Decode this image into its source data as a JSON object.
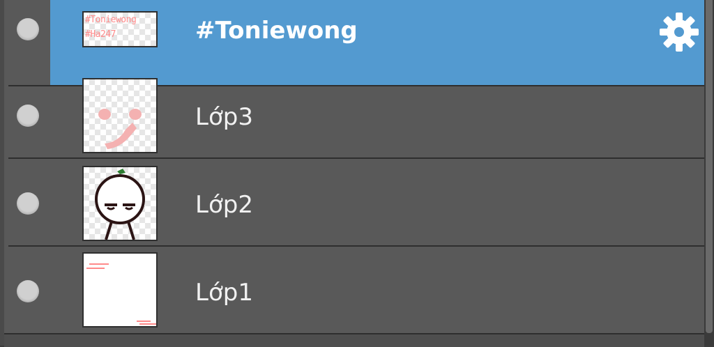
{
  "layers": [
    {
      "name": "#Toniewong",
      "selected": true,
      "thumb_lines": [
        "#Toniewong",
        "#Ha247"
      ],
      "settings_icon": "gear-icon"
    },
    {
      "name": "Lớp3",
      "selected": false
    },
    {
      "name": "Lớp2",
      "selected": false
    },
    {
      "name": "Lớp1",
      "selected": false
    }
  ],
  "colors": {
    "panel_bg": "#595959",
    "selection": "#539ad0",
    "text": "#f1f1f1"
  }
}
